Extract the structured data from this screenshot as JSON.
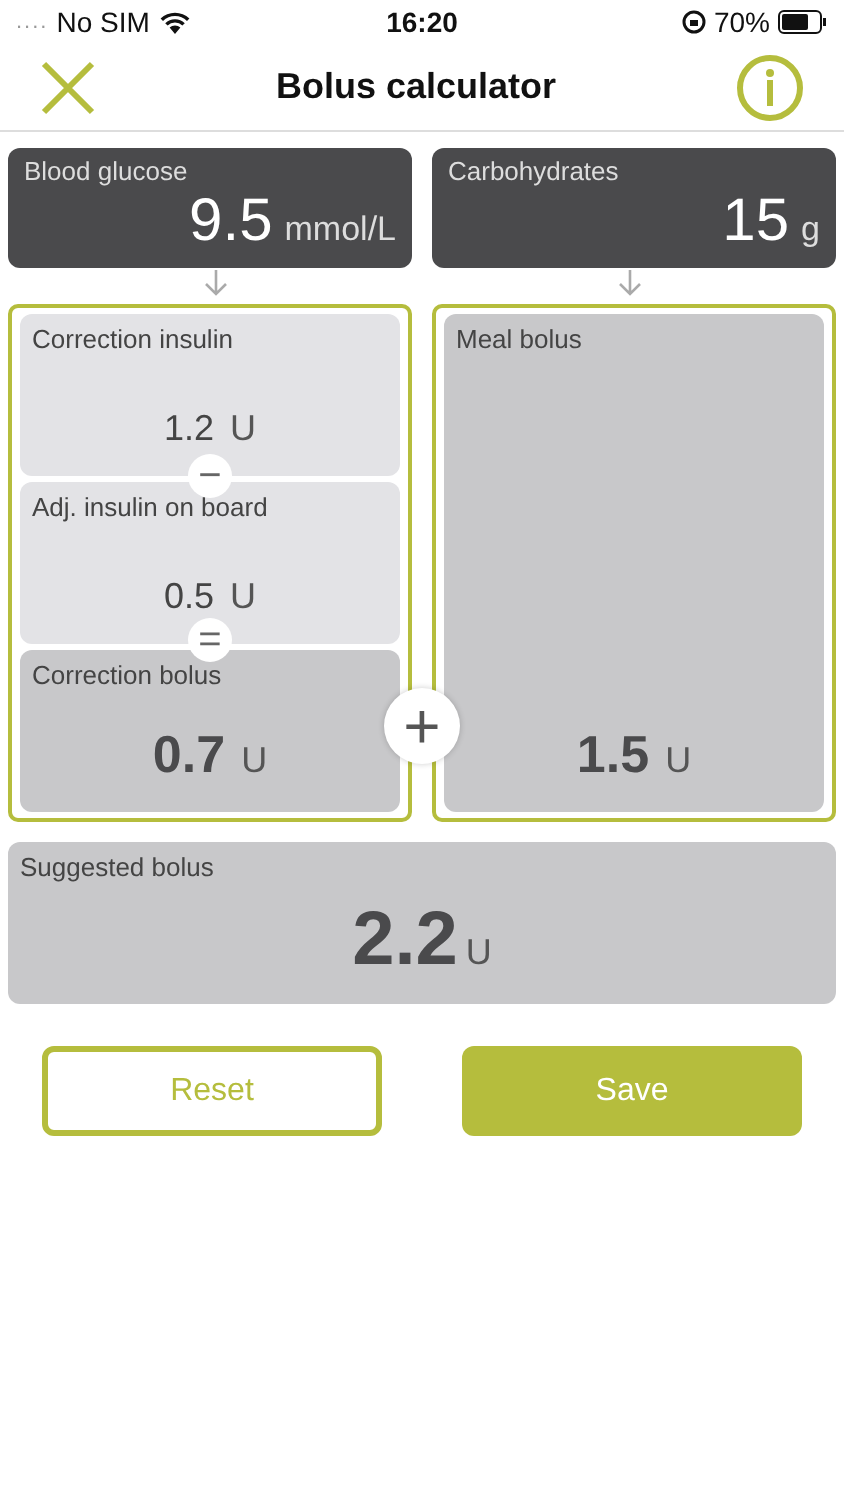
{
  "status_bar": {
    "signal_dots": "....",
    "carrier": "No SIM",
    "time": "16:20",
    "battery": "70%"
  },
  "nav": {
    "title": "Bolus calculator"
  },
  "inputs": [
    {
      "label": "Blood glucose",
      "value": "9.5",
      "unit": "mmol/L"
    },
    {
      "label": "Carbohydrates",
      "value": "15",
      "unit": "g"
    }
  ],
  "correction_steps": [
    {
      "kind": "term",
      "label": "Correction insulin",
      "value": "1.2",
      "unit": "U"
    },
    {
      "kind": "term",
      "label": "Adj. insulin on board",
      "value": "0.5",
      "unit": "U"
    },
    {
      "kind": "result",
      "label": "Correction bolus",
      "value": "0.7",
      "unit": "U"
    }
  ],
  "operators": [
    "−",
    "="
  ],
  "plus_operator": "+",
  "meal_bolus": {
    "label": "Meal bolus",
    "value": "1.5",
    "unit": "U"
  },
  "suggested_bolus": {
    "label": "Suggested bolus",
    "value": "2.2",
    "unit": "U"
  },
  "buttons": [
    {
      "kind": "outline",
      "label": "Reset"
    },
    {
      "kind": "filled",
      "label": "Save"
    }
  ]
}
